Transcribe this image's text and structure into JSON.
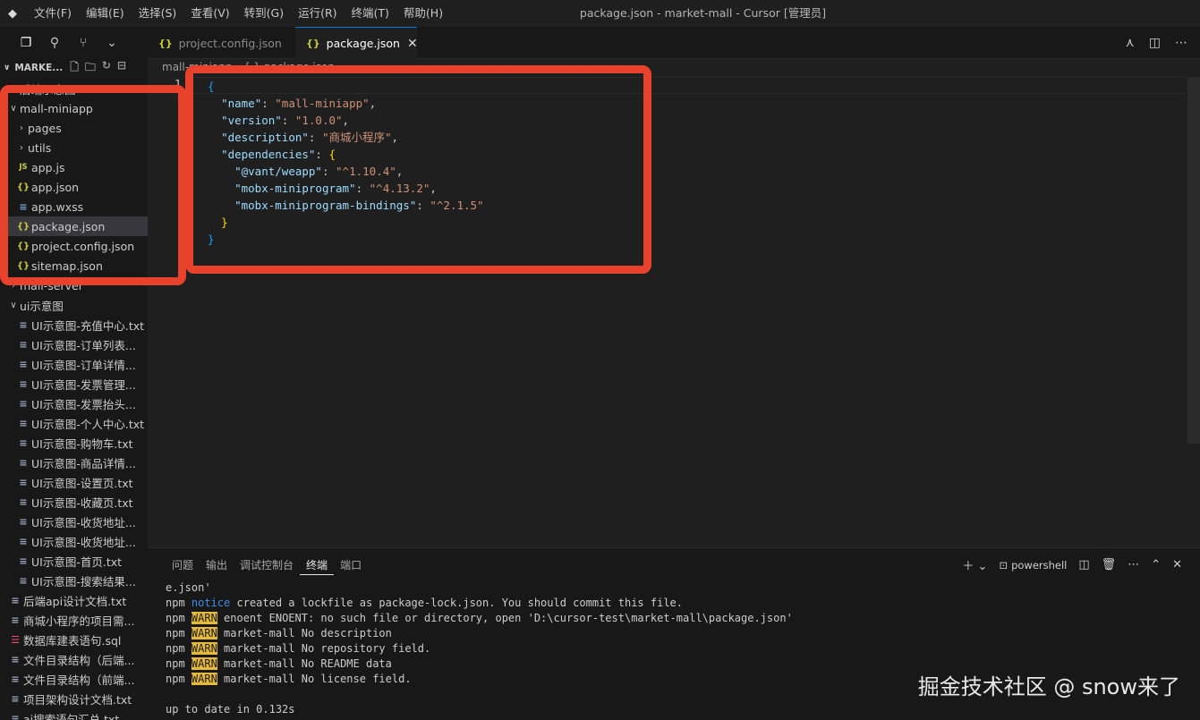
{
  "titlebar": {
    "menu": [
      "文件(F)",
      "编辑(E)",
      "选择(S)",
      "查看(V)",
      "转到(G)",
      "运行(R)",
      "终端(T)",
      "帮助(H)"
    ],
    "window_title": "package.json - market-mall - Cursor [管理员]"
  },
  "explorer": {
    "root_label": "MARKE...",
    "items": [
      {
        "label": "后端示意图",
        "kind": "folder-collapsed",
        "indent": 0
      },
      {
        "label": "mall-miniapp",
        "kind": "folder-open",
        "indent": 0
      },
      {
        "label": "pages",
        "kind": "folder-collapsed",
        "indent": 1
      },
      {
        "label": "utils",
        "kind": "folder-collapsed",
        "indent": 1
      },
      {
        "label": "app.js",
        "kind": "js",
        "indent": 1
      },
      {
        "label": "app.json",
        "kind": "json",
        "indent": 1
      },
      {
        "label": "app.wxss",
        "kind": "wxss",
        "indent": 1
      },
      {
        "label": "package.json",
        "kind": "json",
        "indent": 1,
        "selected": true
      },
      {
        "label": "project.config.json",
        "kind": "json",
        "indent": 1
      },
      {
        "label": "sitemap.json",
        "kind": "json",
        "indent": 1
      },
      {
        "label": "mall-server",
        "kind": "folder-collapsed",
        "indent": 0
      },
      {
        "label": "ui示意图",
        "kind": "folder-open",
        "indent": 0
      },
      {
        "label": "UI示意图-充值中心.txt",
        "kind": "txt",
        "indent": 1
      },
      {
        "label": "UI示意图-订单列表...",
        "kind": "txt",
        "indent": 1
      },
      {
        "label": "UI示意图-订单详情...",
        "kind": "txt",
        "indent": 1
      },
      {
        "label": "UI示意图-发票管理...",
        "kind": "txt",
        "indent": 1
      },
      {
        "label": "UI示意图-发票抬头...",
        "kind": "txt",
        "indent": 1
      },
      {
        "label": "UI示意图-个人中心.txt",
        "kind": "txt",
        "indent": 1
      },
      {
        "label": "UI示意图-购物车.txt",
        "kind": "txt",
        "indent": 1
      },
      {
        "label": "UI示意图-商品详情...",
        "kind": "txt",
        "indent": 1
      },
      {
        "label": "UI示意图-设置页.txt",
        "kind": "txt",
        "indent": 1
      },
      {
        "label": "UI示意图-收藏页.txt",
        "kind": "txt",
        "indent": 1
      },
      {
        "label": "UI示意图-收货地址...",
        "kind": "txt",
        "indent": 1
      },
      {
        "label": "UI示意图-收货地址...",
        "kind": "txt",
        "indent": 1
      },
      {
        "label": "UI示意图-首页.txt",
        "kind": "txt",
        "indent": 1
      },
      {
        "label": "UI示意图-搜索结果...",
        "kind": "txt",
        "indent": 1
      },
      {
        "label": "后端api设计文档.txt",
        "kind": "txt",
        "indent": 0
      },
      {
        "label": "商城小程序的项目需...",
        "kind": "txt",
        "indent": 0
      },
      {
        "label": "数据库建表语句.sql",
        "kind": "sql",
        "indent": 0
      },
      {
        "label": "文件目录结构（后端...",
        "kind": "txt",
        "indent": 0
      },
      {
        "label": "文件目录结构（前端...",
        "kind": "txt",
        "indent": 0
      },
      {
        "label": "项目架构设计文档.txt",
        "kind": "txt",
        "indent": 0
      },
      {
        "label": "ai搜索语句汇总.txt",
        "kind": "txt",
        "indent": 0
      }
    ]
  },
  "tabs": [
    {
      "label": "project.config.json",
      "active": false
    },
    {
      "label": "package.json",
      "active": true
    }
  ],
  "editor": {
    "breadcrumb": "mall-miniapp  ›  { }  package.json",
    "current_line_number": "1",
    "code": [
      [
        {
          "t": "{",
          "c": "b1"
        }
      ],
      [
        {
          "t": "  ",
          "c": "p"
        },
        {
          "t": "\"name\"",
          "c": "k"
        },
        {
          "t": ": ",
          "c": "p"
        },
        {
          "t": "\"mall-miniapp\"",
          "c": "s"
        },
        {
          "t": ",",
          "c": "p"
        }
      ],
      [
        {
          "t": "  ",
          "c": "p"
        },
        {
          "t": "\"version\"",
          "c": "k"
        },
        {
          "t": ": ",
          "c": "p"
        },
        {
          "t": "\"1.0.0\"",
          "c": "s"
        },
        {
          "t": ",",
          "c": "p"
        }
      ],
      [
        {
          "t": "  ",
          "c": "p"
        },
        {
          "t": "\"description\"",
          "c": "k"
        },
        {
          "t": ": ",
          "c": "p"
        },
        {
          "t": "\"商城小程序\"",
          "c": "s"
        },
        {
          "t": ",",
          "c": "p"
        }
      ],
      [
        {
          "t": "  ",
          "c": "p"
        },
        {
          "t": "\"dependencies\"",
          "c": "k"
        },
        {
          "t": ": ",
          "c": "p"
        },
        {
          "t": "{",
          "c": "b2"
        }
      ],
      [
        {
          "t": "    ",
          "c": "p"
        },
        {
          "t": "\"@vant/weapp\"",
          "c": "k"
        },
        {
          "t": ": ",
          "c": "p"
        },
        {
          "t": "\"^1.10.4\"",
          "c": "s"
        },
        {
          "t": ",",
          "c": "p"
        }
      ],
      [
        {
          "t": "    ",
          "c": "p"
        },
        {
          "t": "\"mobx-miniprogram\"",
          "c": "k"
        },
        {
          "t": ": ",
          "c": "p"
        },
        {
          "t": "\"^4.13.2\"",
          "c": "s"
        },
        {
          "t": ",",
          "c": "p"
        }
      ],
      [
        {
          "t": "    ",
          "c": "p"
        },
        {
          "t": "\"mobx-miniprogram-bindings\"",
          "c": "k"
        },
        {
          "t": ": ",
          "c": "p"
        },
        {
          "t": "\"^2.1.5\"",
          "c": "s"
        }
      ],
      [
        {
          "t": "  ",
          "c": "p"
        },
        {
          "t": "}",
          "c": "b2"
        }
      ],
      [
        {
          "t": "}",
          "c": "b1"
        }
      ]
    ]
  },
  "panel": {
    "tabs": [
      "问题",
      "输出",
      "调试控制台",
      "终端",
      "端口"
    ],
    "active_tab": "终端",
    "shell_label": "powershell",
    "terminal_lines": [
      [
        {
          "t": "e.json'"
        }
      ],
      [
        {
          "t": "npm "
        },
        {
          "t": "notice",
          "c": "notice"
        },
        {
          "t": " created a lockfile as package-lock.json. You should commit this file."
        }
      ],
      [
        {
          "t": "npm "
        },
        {
          "t": "WARN",
          "c": "warn"
        },
        {
          "t": " enoent",
          "c": "warnword"
        },
        {
          "t": " ENOENT: no such file or directory, open 'D:\\cursor-test\\market-mall\\package.json'"
        }
      ],
      [
        {
          "t": "npm "
        },
        {
          "t": "WARN",
          "c": "warn"
        },
        {
          "t": " market-mall No description"
        }
      ],
      [
        {
          "t": "npm "
        },
        {
          "t": "WARN",
          "c": "warn"
        },
        {
          "t": " market-mall No repository field."
        }
      ],
      [
        {
          "t": "npm "
        },
        {
          "t": "WARN",
          "c": "warn"
        },
        {
          "t": " market-mall No README data"
        }
      ],
      [
        {
          "t": "npm "
        },
        {
          "t": "WARN",
          "c": "warn"
        },
        {
          "t": " market-mall No license field."
        }
      ],
      [
        {
          "t": ""
        }
      ],
      [
        {
          "t": "up to date in 0.132s"
        }
      ]
    ]
  },
  "watermark": "掘金技术社区 @ snow来了",
  "colors": {
    "accent_red_box": "#e8412c",
    "json_key": "#9cdcfe",
    "json_string": "#ce9178",
    "warn_bg": "#e5b93d",
    "notice": "#3b8eea"
  }
}
